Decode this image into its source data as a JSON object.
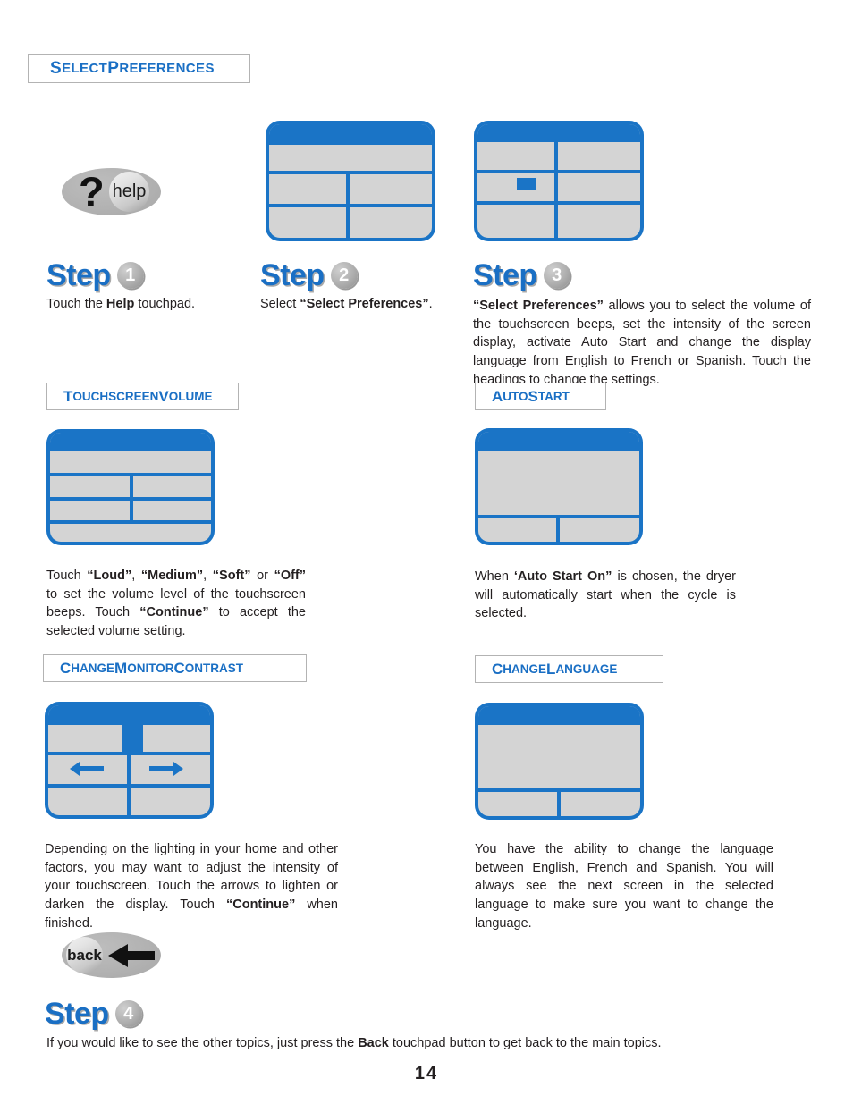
{
  "page": {
    "title": "Select Preferences",
    "title_first": "S",
    "title_rest": "ELECT ",
    "title_word2_first": "P",
    "title_word2_rest": "REFERENCES",
    "number": "14"
  },
  "buttons": {
    "help": {
      "label": "help",
      "glyph": "?"
    },
    "back": {
      "label": "back",
      "arrow_icon": "left-arrow-icon"
    }
  },
  "steps": [
    {
      "word": "Step",
      "number": "1",
      "text_plain": "Touch the Help touchpad.",
      "text_pre": "Touch the ",
      "text_bold": "Help",
      "text_post": " touchpad."
    },
    {
      "word": "Step",
      "number": "2",
      "text_plain": "Select “Select Preferences”.",
      "text_pre": "Select ",
      "text_bold": "“Select Preferences”",
      "text_post": "."
    },
    {
      "word": "Step",
      "number": "3",
      "text_plain": "“Select Preferences” allows you to select the volume of the touchscreen beeps, set the intensity of the screen display, activate Auto Start and change the display language from English to French or Spanish. Touch the headings to change the settings.",
      "text_pre": "",
      "text_bold": "“Select Preferences”",
      "text_post": " allows you to select the volume of the touchscreen beeps, set the intensity of the screen display, activate Auto Start and change the display language from English to French or Spanish. Touch the headings to change the settings."
    },
    {
      "word": "Step",
      "number": "4",
      "text_plain": "If you would like to see the other topics, just press the Back touchpad button to get back to the main topics.",
      "text_pre": "If you would like to see the other topics, just press the ",
      "text_bold": "Back",
      "text_post": " touchpad button to get back to the main topics."
    }
  ],
  "sections": [
    {
      "heading": "Touchscreen Volume",
      "heading_first": "T",
      "heading_rest": "OUCHSCREEN ",
      "heading_word2_first": "V",
      "heading_word2_rest": "OLUME",
      "body_plain": "Touch “Loud”, “Medium”, “Soft” or “Off” to set the volume level of the touchscreen beeps. Touch “Continue” to accept the selected volume setting."
    },
    {
      "heading": "Auto Start",
      "heading_first": "A",
      "heading_rest": "UTO ",
      "heading_word2_first": "S",
      "heading_word2_rest": "TART",
      "body_plain": "When ‘Auto Start On” is chosen, the dryer will automatically start when the cycle is selected."
    },
    {
      "heading": "Change Monitor Contrast",
      "heading_first": "C",
      "heading_rest": "HANGE ",
      "heading_word2_first": "M",
      "heading_word2_rest": "ONITOR ",
      "heading_word3_first": "C",
      "heading_word3_rest": "ONTRAST",
      "body_plain": "Depending on the lighting in your home and other factors, you may want to adjust the intensity of your touchscreen. Touch the arrows to lighten or darken the display. Touch “Continue” when finished."
    },
    {
      "heading": "Change Language",
      "heading_first": "C",
      "heading_rest": "HANGE ",
      "heading_word2_first": "L",
      "heading_word2_rest": "ANGUAGE",
      "body_plain": "You have the ability to change the language between English, French and Spanish. You will always see the next screen in the selected language to make sure you want to change the language."
    }
  ],
  "section_body_fragments": {
    "volume": {
      "p1": "Touch ",
      "b1": "“Loud”",
      "p2": ", ",
      "b2": "“Medium”",
      "p3": ", ",
      "b3": "“Soft”",
      "p4": " or ",
      "b4": "“Off”",
      "p5": " to set the volume level of the touchscreen beeps. Touch ",
      "b5": "“Continue”",
      "p6": " to accept the selected volume setting."
    },
    "autostart": {
      "p1": "When ",
      "b1": "‘Auto Start On”",
      "p2": " is chosen, the dryer will automatically start when the cycle is selected."
    },
    "contrast": {
      "p1": "Depending on the lighting in your home and other factors, you may want to adjust the intensity of your touchscreen. Touch the arrows to lighten or darken the display. Touch ",
      "b1": "“Continue”",
      "p2": " when finished."
    },
    "language": {
      "p1": "You have the ability to change the language between English, French and Spanish. You will always see the next screen in the selected language to make sure you want to change the language."
    }
  },
  "screens": {
    "step2": {
      "name": "help-menu-screen"
    },
    "step3": {
      "name": "select-preferences-screen",
      "selection_indicator": "blue-block"
    },
    "volume": {
      "name": "touchscreen-volume-screen"
    },
    "autostart": {
      "name": "auto-start-screen"
    },
    "contrast": {
      "name": "monitor-contrast-screen",
      "left_arrow": "left-arrow-icon",
      "right_arrow": "right-arrow-icon"
    },
    "language": {
      "name": "change-language-screen"
    }
  },
  "colors": {
    "accent_blue": "#1a74c6",
    "heading_blue": "#1a6fc4",
    "screen_gray": "#d4d4d4",
    "button_gray": "#b2b2b2",
    "text": "#231f20"
  }
}
